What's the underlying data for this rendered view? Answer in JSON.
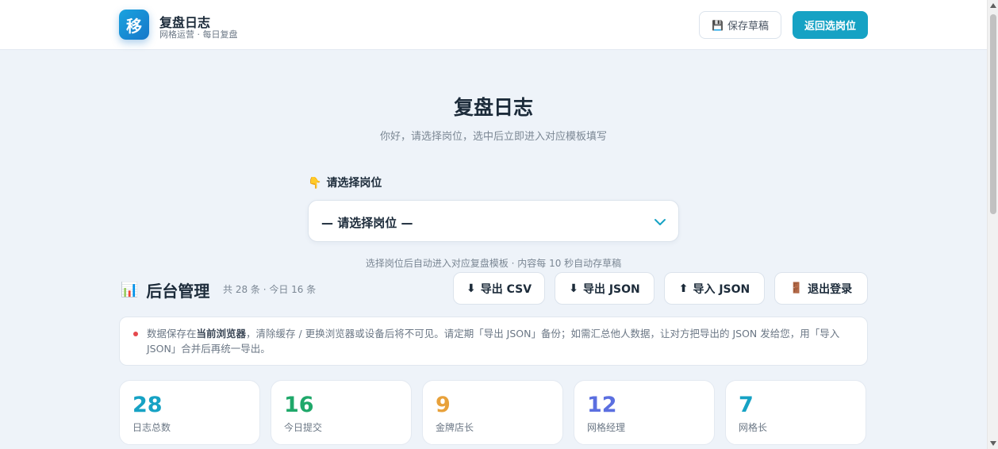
{
  "header": {
    "logo_char": "移",
    "title": "复盘日志",
    "subtitle": "网格运营 · 每日复盘",
    "save_draft_icon": "💾",
    "save_draft_label": "保存草稿",
    "back_label": "返回选岗位"
  },
  "hero": {
    "title": "复盘日志",
    "subtitle": "你好，请选择岗位，选中后立即进入对应模板填写"
  },
  "role_select": {
    "label_icon": "👇",
    "label": "请选择岗位",
    "value": "— 请选择岗位 —",
    "hint": "选择岗位后自动进入对应复盘模板 · 内容每 10 秒自动存草稿"
  },
  "admin": {
    "icon": "📊",
    "title": "后台管理",
    "meta": "共 28 条 · 今日 16 条",
    "buttons": [
      {
        "icon": "⬇",
        "label": "导出 CSV"
      },
      {
        "icon": "⬇",
        "label": "导出 JSON"
      },
      {
        "icon": "⬆",
        "label": "导入 JSON"
      },
      {
        "icon": "🚪",
        "label": "退出登录"
      }
    ],
    "notice_pre": "数据保存在",
    "notice_bold": "当前浏览器",
    "notice_post": "，清除缓存 / 更换浏览器或设备后将不可见。请定期「导出 JSON」备份；如需汇总他人数据，让对方把导出的 JSON 发给您，用「导入 JSON」合并后再统一导出。"
  },
  "stats": [
    {
      "value": "28",
      "label": "日志总数",
      "color": "#16a2c4"
    },
    {
      "value": "16",
      "label": "今日提交",
      "color": "#1fa86a"
    },
    {
      "value": "9",
      "label": "金牌店长",
      "color": "#e8a13a"
    },
    {
      "value": "12",
      "label": "网格经理",
      "color": "#5b6fe0"
    },
    {
      "value": "7",
      "label": "网格长",
      "color": "#16a2c4"
    }
  ],
  "colors": {
    "accent": "#16a2c4",
    "background": "#eef3f9"
  }
}
